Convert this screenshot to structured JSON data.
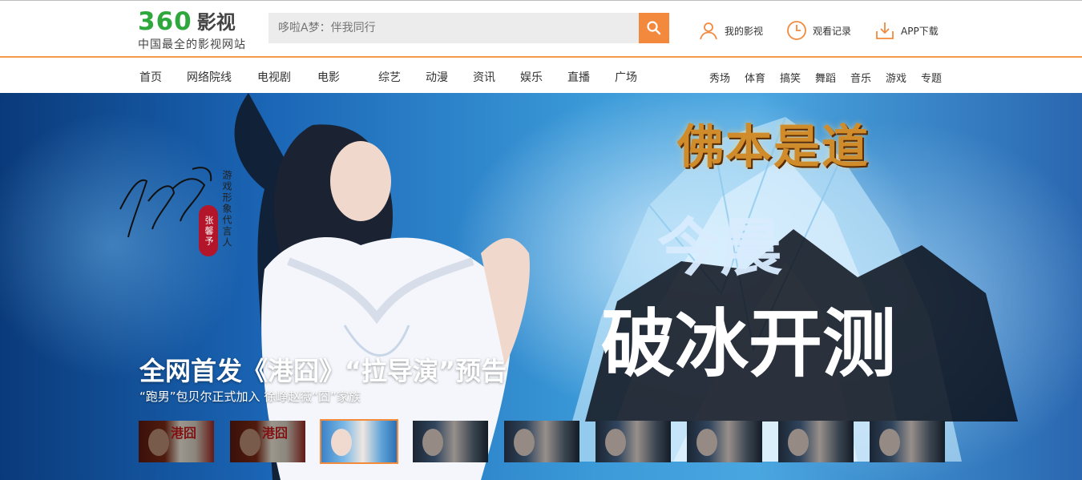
{
  "header": {
    "logo_number": "360",
    "logo_text": "影视",
    "logo_tagline": "中国最全的影视网站",
    "search_placeholder": "哆啦A梦：伴我同行",
    "tools": [
      {
        "label": "我的影视",
        "icon": "user-icon"
      },
      {
        "label": "观看记录",
        "icon": "clock-icon"
      },
      {
        "label": "APP下载",
        "icon": "download-icon"
      }
    ],
    "accent_color": "#f2893d",
    "logo_color": "#2ea83c"
  },
  "nav": {
    "main": [
      "首页",
      "网络院线",
      "电视剧",
      "电影",
      "综艺",
      "动漫",
      "资讯",
      "娱乐",
      "直播",
      "广场"
    ],
    "secondary": [
      "秀场",
      "体育",
      "搞笑",
      "舞蹈",
      "音乐",
      "游戏",
      "专题"
    ]
  },
  "banner": {
    "title_art": "佛本是道",
    "brush_top": "今晨",
    "brush_bottom": "破冰开测",
    "spokesperson_vertical": "游戏形象代言人",
    "seal_name": "张馨予",
    "caption": "全网首发《港囧》“拉导演”预告",
    "subcaption": "“跑男”包贝尔正式加入 徐峥赵薇“囧”家族",
    "thumbnails": [
      {
        "label": "港囧",
        "style": "poster",
        "active": false
      },
      {
        "label": "港囧",
        "style": "poster",
        "active": false
      },
      {
        "label": "",
        "style": "portrait",
        "active": true
      },
      {
        "label": "",
        "style": "portrait",
        "active": false
      },
      {
        "label": "",
        "style": "portrait",
        "active": false
      },
      {
        "label": "",
        "style": "portrait",
        "active": false
      },
      {
        "label": "",
        "style": "portrait",
        "active": false
      },
      {
        "label": "",
        "style": "portrait",
        "active": false
      },
      {
        "label": "",
        "style": "portrait",
        "active": false
      }
    ]
  }
}
